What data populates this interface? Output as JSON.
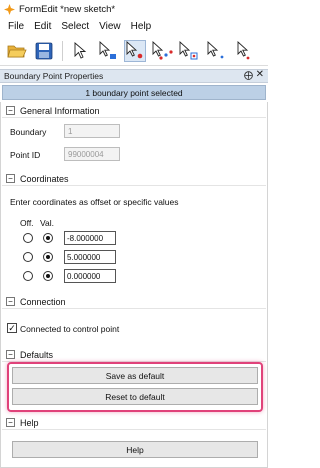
{
  "window": {
    "title": "FormEdit *new sketch*"
  },
  "menu": [
    "File",
    "Edit",
    "Select",
    "View",
    "Help"
  ],
  "panel": {
    "title": "Boundary Point Properties",
    "pin_glyph": "⨁",
    "close_glyph": "✕",
    "status": "1 boundary point selected"
  },
  "general": {
    "heading": "General Information",
    "toggle": "−",
    "boundary_label": "Boundary",
    "boundary_value": "1",
    "point_id_label": "Point ID",
    "point_id_value": "99000004"
  },
  "coordinates": {
    "heading": "Coordinates",
    "toggle": "−",
    "hint": "Enter coordinates as offset or specific values",
    "col_off": "Off.",
    "col_val": "Val.",
    "rows": [
      {
        "value": "-8.000000",
        "mode": "Val."
      },
      {
        "value": "5.000000",
        "mode": "Val."
      },
      {
        "value": "0.000000",
        "mode": "Val."
      }
    ]
  },
  "connection": {
    "heading": "Connection",
    "toggle": "−",
    "checkbox_label": "Connected to control point",
    "checked": true,
    "check_glyph": "✓"
  },
  "defaults": {
    "heading": "Defaults",
    "toggle": "−",
    "save_label": "Save as default",
    "reset_label": "Reset to default",
    "highlight_color": "#e0427a"
  },
  "help": {
    "heading": "Help",
    "toggle": "−",
    "button_label": "Help"
  },
  "colors": {
    "status_bar": "#bcd0e6",
    "panel_header": "#dde6f0",
    "icon_orange": "#f29a1a",
    "cursor_node_red": "#d92b2b",
    "cursor_node_blue": "#2b6fd9"
  }
}
